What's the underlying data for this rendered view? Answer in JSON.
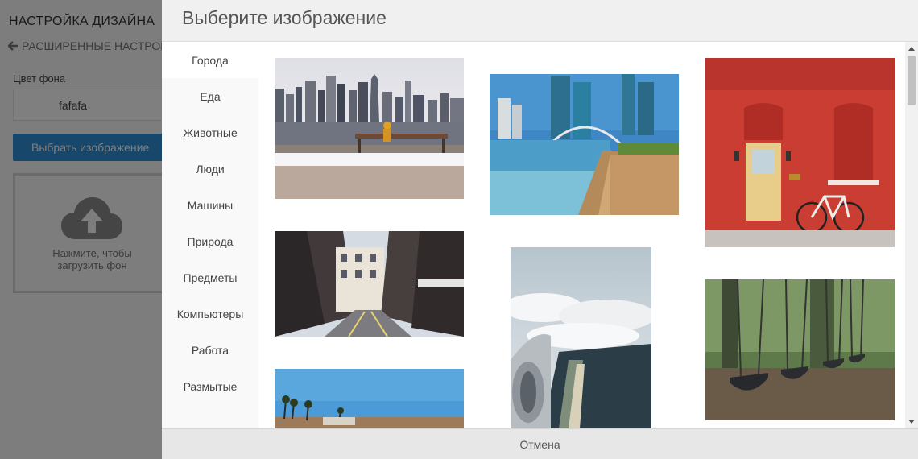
{
  "panel": {
    "title": "НАСТРОЙКА ДИЗАЙНА",
    "back_label": "РАСШИРЕННЫЕ НАСТРОЙКИ",
    "bg_color_label": "Цвет фона",
    "bg_color_value": "fafafa",
    "choose_button": "Выбрать изображение",
    "upload_text_line1": "Нажмите, чтобы",
    "upload_text_line2": "загрузить фон"
  },
  "modal": {
    "title": "Выберите изображение",
    "categories": [
      {
        "label": "Города",
        "active": true
      },
      {
        "label": "Еда"
      },
      {
        "label": "Животные"
      },
      {
        "label": "Люди"
      },
      {
        "label": "Машины"
      },
      {
        "label": "Природа"
      },
      {
        "label": "Предметы"
      },
      {
        "label": "Компьютеры"
      },
      {
        "label": "Работа"
      },
      {
        "label": "Размытые"
      }
    ],
    "images": [
      {
        "subject": "city-skyline-waterfront"
      },
      {
        "subject": "city-canal-bridge"
      },
      {
        "subject": "red-brick-wall-bicycle"
      },
      {
        "subject": "narrow-city-street"
      },
      {
        "subject": "airplane-window-clouds"
      },
      {
        "subject": "playground-swings"
      },
      {
        "subject": "palm-trees-coast"
      }
    ],
    "cancel_label": "Отмена"
  },
  "colors": {
    "accent": "#2f8ed6",
    "overlay": "rgba(0,0,0,0.5)"
  }
}
